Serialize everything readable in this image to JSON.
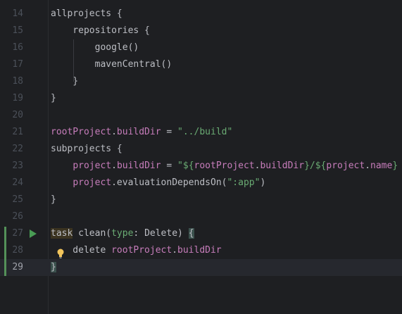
{
  "editor": {
    "top_line_number": "13",
    "lines": [
      {
        "num": "14",
        "segments": [
          {
            "t": "allprojects {",
            "c": "kw"
          }
        ]
      },
      {
        "num": "15",
        "segments": [
          {
            "t": "    repositories {",
            "c": "kw"
          }
        ]
      },
      {
        "num": "16",
        "segments": [
          {
            "t": "        google()",
            "c": "kw"
          }
        ]
      },
      {
        "num": "17",
        "segments": [
          {
            "t": "        mavenCentral()",
            "c": "kw"
          }
        ]
      },
      {
        "num": "18",
        "segments": [
          {
            "t": "    }",
            "c": "kw"
          }
        ]
      },
      {
        "num": "19",
        "segments": [
          {
            "t": "}",
            "c": "kw"
          }
        ]
      },
      {
        "num": "20",
        "segments": []
      },
      {
        "num": "21",
        "segments": [
          {
            "t": "rootProject",
            "c": "prop"
          },
          {
            "t": ".",
            "c": "kw"
          },
          {
            "t": "buildDir",
            "c": "prop"
          },
          {
            "t": " = ",
            "c": "kw"
          },
          {
            "t": "\"../build\"",
            "c": "str"
          }
        ]
      },
      {
        "num": "22",
        "segments": [
          {
            "t": "subprojects {",
            "c": "kw"
          }
        ]
      },
      {
        "num": "23",
        "segments": [
          {
            "t": "    ",
            "c": "kw"
          },
          {
            "t": "project",
            "c": "prop"
          },
          {
            "t": ".",
            "c": "kw"
          },
          {
            "t": "buildDir",
            "c": "prop"
          },
          {
            "t": " = ",
            "c": "kw"
          },
          {
            "t": "\"${",
            "c": "str"
          },
          {
            "t": "rootProject",
            "c": "prop"
          },
          {
            "t": ".",
            "c": "kw"
          },
          {
            "t": "buildDir",
            "c": "prop"
          },
          {
            "t": "}/${",
            "c": "str"
          },
          {
            "t": "project",
            "c": "prop"
          },
          {
            "t": ".",
            "c": "kw"
          },
          {
            "t": "name",
            "c": "prop"
          },
          {
            "t": "}",
            "c": "str"
          }
        ]
      },
      {
        "num": "24",
        "segments": [
          {
            "t": "    ",
            "c": "kw"
          },
          {
            "t": "project",
            "c": "prop"
          },
          {
            "t": ".evaluationDependsOn(",
            "c": "kw"
          },
          {
            "t": "\":app\"",
            "c": "str"
          },
          {
            "t": ")",
            "c": "kw"
          }
        ]
      },
      {
        "num": "25",
        "segments": [
          {
            "t": "}",
            "c": "kw"
          }
        ]
      },
      {
        "num": "26",
        "segments": []
      },
      {
        "num": "27",
        "segments": [
          {
            "t": "task",
            "c": "kw hl-task"
          },
          {
            "t": " clean(",
            "c": "kw"
          },
          {
            "t": "type",
            "c": "str"
          },
          {
            "t": ": Delete) ",
            "c": "kw"
          },
          {
            "t": "{",
            "c": "kw brace-match"
          }
        ]
      },
      {
        "num": "28",
        "segments": [
          {
            "t": "    delete ",
            "c": "kw"
          },
          {
            "t": "rootProject",
            "c": "prop"
          },
          {
            "t": ".",
            "c": "kw"
          },
          {
            "t": "buildDir",
            "c": "prop"
          }
        ]
      },
      {
        "num": "29",
        "segments": [
          {
            "t": "}",
            "c": "kw brace-match"
          }
        ]
      }
    ],
    "current_line": "29",
    "colors": {
      "background": "#1e1f22",
      "current_line": "#26282e",
      "text": "#bcbec4",
      "property": "#c77dbb",
      "string": "#6aab73",
      "vcs_added": "#549159",
      "run_icon": "#499c54"
    },
    "icons": {
      "run": "run-gutter-icon",
      "intention": "lightbulb-icon"
    }
  }
}
